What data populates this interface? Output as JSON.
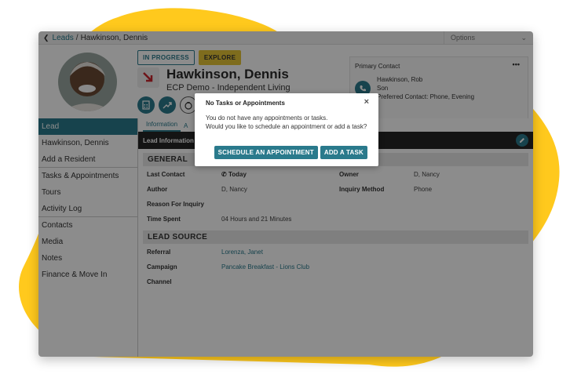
{
  "colors": {
    "accent": "#2a7a8c",
    "yellow_blob": "#ffc91d",
    "explore": "#e6c536"
  },
  "breadcrumb": {
    "back_icon": "chevron-left-icon",
    "parent": "Leads",
    "separator": "/",
    "current": "Hawkinson, Dennis"
  },
  "options": {
    "label": "Options",
    "icon": "chevron-down-icon"
  },
  "status": {
    "in_progress": "IN PROGRESS",
    "explore": "EXPLORE"
  },
  "profile": {
    "name": "Hawkinson, Dennis",
    "community": "ECP Demo - Independent Living",
    "trend_icon": "arrow-down-right-icon",
    "action_icons": [
      "calculator-icon",
      "trend-up-icon",
      "money-bag-icon"
    ]
  },
  "primary_contact": {
    "title": "Primary Contact",
    "more": "•••",
    "name": "Hawkinson, Rob",
    "relation": "Son",
    "preferred": "Preferred Contact: Phone, Evening"
  },
  "sidebar": {
    "items": [
      {
        "label": "Lead",
        "active": true
      },
      {
        "label": "Hawkinson, Dennis"
      },
      {
        "label": "Add a Resident"
      },
      {
        "label": "Tasks & Appointments"
      },
      {
        "label": "Tours"
      },
      {
        "label": "Activity Log"
      },
      {
        "label": "Contacts"
      },
      {
        "label": "Media"
      },
      {
        "label": "Notes"
      },
      {
        "label": "Finance & Move In"
      }
    ]
  },
  "tabs": [
    {
      "label": "Information"
    },
    {
      "label": "A"
    }
  ],
  "section_title": "Lead Information",
  "general": {
    "heading": "GENERAL",
    "last_contact_label": "Last Contact",
    "last_contact_value": "Today",
    "owner_label": "Owner",
    "owner_value": "D, Nancy",
    "author_label": "Author",
    "author_value": "D, Nancy",
    "inquiry_method_label": "Inquiry Method",
    "inquiry_method_value": "Phone",
    "reason_label": "Reason For Inquiry",
    "time_spent_label": "Time Spent",
    "time_spent_value": "04 Hours and 21 Minutes"
  },
  "lead_source": {
    "heading": "LEAD SOURCE",
    "referral_label": "Referral",
    "referral_value": "Lorenza, Janet",
    "campaign_label": "Campaign",
    "campaign_value": "Pancake Breakfast - Lions Club",
    "channel_label": "Channel"
  },
  "dialog": {
    "title": "No Tasks or Appointments",
    "close": "×",
    "line1": "You do not have any appointments or tasks.",
    "line2": "Would you like to schedule an appointment or add a task?",
    "schedule_button": "SCHEDULE AN APPOINTMENT",
    "add_task_button": "ADD A TASK"
  }
}
